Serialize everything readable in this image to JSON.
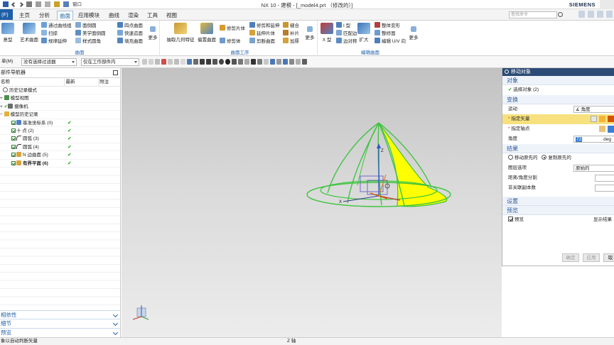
{
  "window": {
    "title": "NX 10 - 建模 - [_model4.prt （修改的）]",
    "brand": "SIEMENS",
    "quick_access_window": "窗口"
  },
  "menu": {
    "file": "(F)",
    "tabs": [
      "主页",
      "分析",
      "曲面",
      "应用模块",
      "曲线",
      "渲染",
      "工具",
      "视图"
    ],
    "active_tab": "曲面",
    "search_placeholder": "查找命令"
  },
  "ribbon": {
    "group_surface": {
      "title": "曲面",
      "big_buttons": [
        "意型",
        "艺术曲面"
      ],
      "small_col1": [
        "通过曲线组",
        "扫掠",
        "规律延伸"
      ],
      "small_col2": [
        "面倒圆",
        "美学面倒圆",
        "样式圆角"
      ],
      "small_col3": [
        "四点曲面",
        "快速造面",
        "填充曲面"
      ],
      "more": "更多"
    },
    "group_surface_ops": {
      "title": "曲面工序",
      "big_buttons": [
        "抽取几何特征",
        "偏置曲面"
      ],
      "small_col1": [
        "修剪片体",
        "修剪体"
      ],
      "small_col2": [
        "修剪和延伸",
        "延伸片体",
        "剪断曲面"
      ],
      "small_col3": [
        "缝合",
        "补片",
        "加厚"
      ],
      "more": "更多"
    },
    "group_edit_surface": {
      "title": "编辑曲面",
      "big_buttons": [
        "X 型",
        "扩大"
      ],
      "small_col1": [
        "I 型",
        "匹配边",
        "边对称"
      ],
      "small_col2": [
        "整体变形",
        "整修面",
        "编辑 U/V 向"
      ],
      "more": "更多"
    }
  },
  "toolbar": {
    "menu_label": "单(M)",
    "filter_select": "没有选择过滤器",
    "scope_select": "仅在工作部件内"
  },
  "navigator": {
    "title": "部件导航器",
    "columns": [
      "名称",
      "最新",
      "附注"
    ],
    "items": [
      {
        "label": "历史记录模式",
        "check": ""
      },
      {
        "label": "模型视图",
        "check": ""
      },
      {
        "label": "摄像机",
        "check": ""
      },
      {
        "label": "模型历史记录",
        "check": ""
      },
      {
        "label": "基准坐标系 (0)",
        "check": "✔"
      },
      {
        "label": "十 点 (2)",
        "check": "✔"
      },
      {
        "label": "圆弧 (3)",
        "check": "✔"
      },
      {
        "label": "圆弧 (4)",
        "check": "✔"
      },
      {
        "label": "N 边曲面 (5)",
        "check": "✔"
      },
      {
        "label": "有界平面 (6)",
        "check": "✔"
      }
    ],
    "panels": [
      "相依性",
      "细节",
      "预览"
    ]
  },
  "dialog": {
    "title": "移动对象",
    "sect_object": "对象",
    "select_object": "选择对象 (2)",
    "sect_transform": "变换",
    "motion_label": "运动",
    "motion_value": "角度",
    "specify_vector": "指定矢量",
    "specify_axis_point": "指定轴点",
    "angle_label": "角度",
    "angle_value": "72",
    "angle_unit": "deg",
    "sect_result": "结果",
    "move_original": "移动原先的",
    "copy_original": "复制原先的",
    "layer_label": "图层选项",
    "layer_value": "原始的",
    "distance_label": "距离/角度分割",
    "copies_label": "非关联副本数",
    "sect_settings": "设置",
    "sect_preview": "预览",
    "preview_label": "预览",
    "show_result": "显示结果",
    "ok": "确定",
    "apply": "应用",
    "cancel": "取"
  },
  "viewport": {
    "z_label": "Z",
    "x_label": "X"
  },
  "status": {
    "left": "象以自动判断矢量",
    "center": "Z 轴"
  }
}
